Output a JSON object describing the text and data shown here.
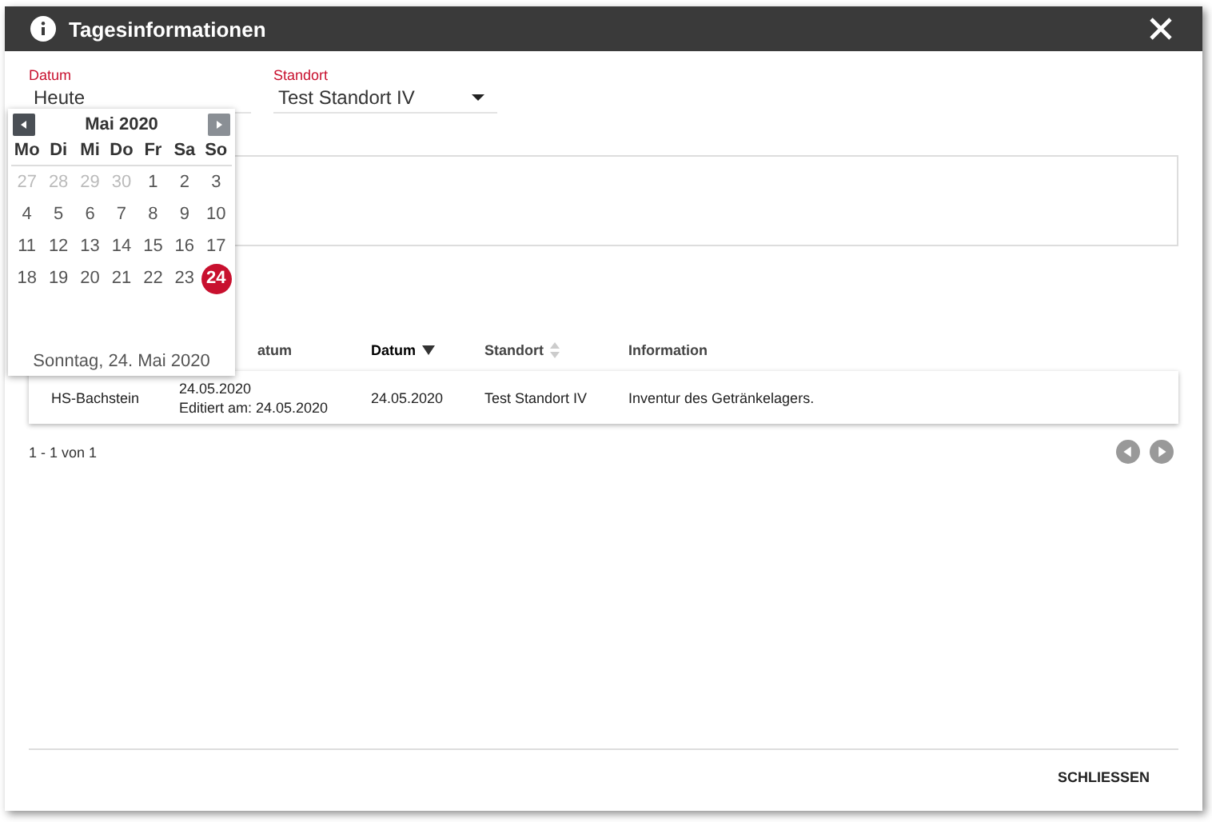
{
  "window": {
    "title": "Tagesinformationen"
  },
  "datum_field": {
    "label": "Datum",
    "value": "Heute"
  },
  "standort_field": {
    "label": "Standort",
    "value": "Test Standort IV"
  },
  "calendar": {
    "month": "Mai 2020",
    "weekdays": [
      "Mo",
      "Di",
      "Mi",
      "Do",
      "Fr",
      "Sa",
      "So"
    ],
    "weeks": [
      [
        {
          "label": "27",
          "muted": true,
          "selected": false
        },
        {
          "label": "28",
          "muted": true,
          "selected": false
        },
        {
          "label": "29",
          "muted": true,
          "selected": false
        },
        {
          "label": "30",
          "muted": true,
          "selected": false
        },
        {
          "label": "1",
          "muted": false,
          "selected": false
        },
        {
          "label": "2",
          "muted": false,
          "selected": false
        },
        {
          "label": "3",
          "muted": false,
          "selected": false
        }
      ],
      [
        {
          "label": "4",
          "muted": false,
          "selected": false
        },
        {
          "label": "5",
          "muted": false,
          "selected": false
        },
        {
          "label": "6",
          "muted": false,
          "selected": false
        },
        {
          "label": "7",
          "muted": false,
          "selected": false
        },
        {
          "label": "8",
          "muted": false,
          "selected": false
        },
        {
          "label": "9",
          "muted": false,
          "selected": false
        },
        {
          "label": "10",
          "muted": false,
          "selected": false
        }
      ],
      [
        {
          "label": "11",
          "muted": false,
          "selected": false
        },
        {
          "label": "12",
          "muted": false,
          "selected": false
        },
        {
          "label": "13",
          "muted": false,
          "selected": false
        },
        {
          "label": "14",
          "muted": false,
          "selected": false
        },
        {
          "label": "15",
          "muted": false,
          "selected": false
        },
        {
          "label": "16",
          "muted": false,
          "selected": false
        },
        {
          "label": "17",
          "muted": false,
          "selected": false
        }
      ],
      [
        {
          "label": "18",
          "muted": false,
          "selected": false
        },
        {
          "label": "19",
          "muted": false,
          "selected": false
        },
        {
          "label": "20",
          "muted": false,
          "selected": false
        },
        {
          "label": "21",
          "muted": false,
          "selected": false
        },
        {
          "label": "22",
          "muted": false,
          "selected": false
        },
        {
          "label": "23",
          "muted": false,
          "selected": false
        },
        {
          "label": "24",
          "muted": false,
          "selected": true
        }
      ]
    ],
    "footer": "Sonntag, 24. Mai 2020"
  },
  "table": {
    "columns": [
      {
        "label": "atum",
        "kind": "plain",
        "sorted": false
      },
      {
        "label": "Datum",
        "kind": "sortable",
        "sorted": true
      },
      {
        "label": "Standort",
        "kind": "sortable",
        "sorted": false
      },
      {
        "label": "Information",
        "kind": "plain",
        "sorted": false
      }
    ],
    "rows": [
      {
        "column_1": "HS-Bachstein",
        "column_2": [
          "24.05.2020",
          "Editiert am: 24.05.2020"
        ],
        "datum": "24.05.2020",
        "standort": "Test Standort IV",
        "information": "Inventur des Getränkelagers."
      }
    ]
  },
  "pagination": {
    "range": "1 - 1 von 1"
  },
  "buttons": [
    "SCHLIESSEN"
  ]
}
